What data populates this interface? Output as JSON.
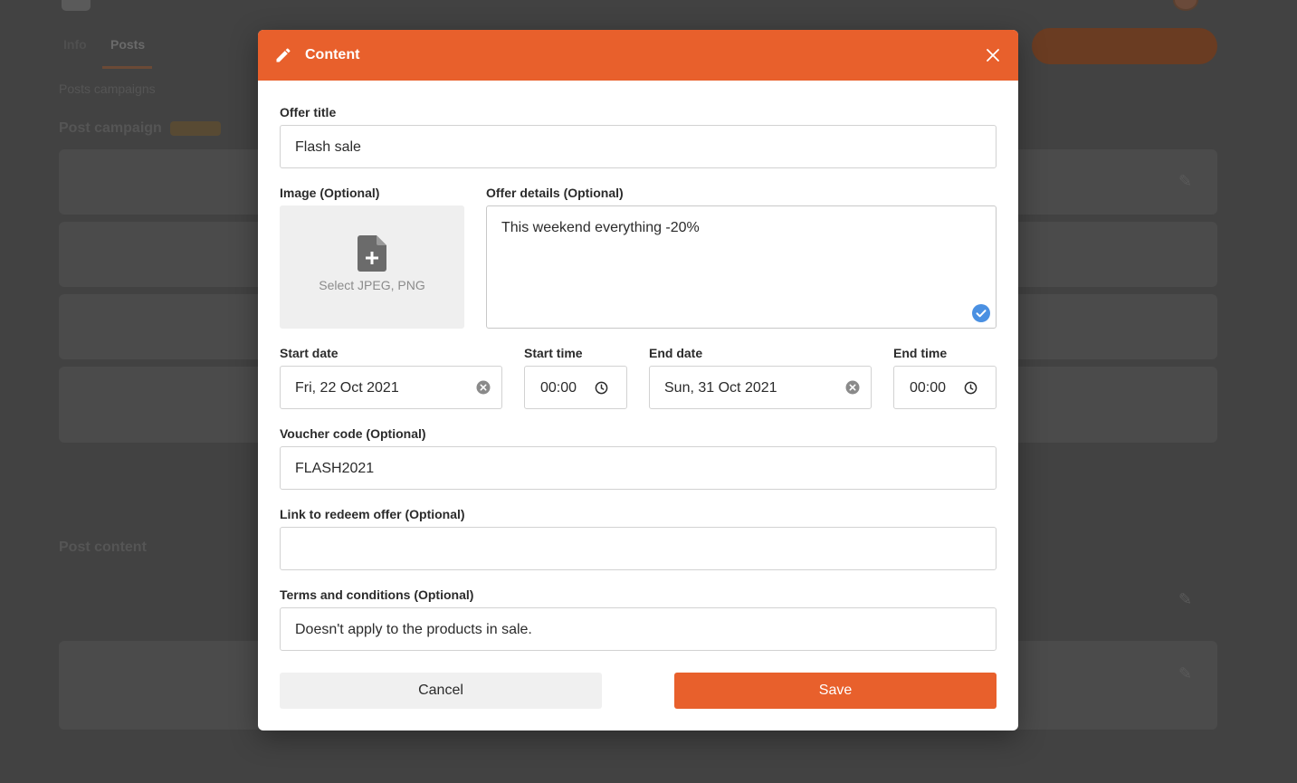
{
  "background": {
    "tabs": [
      "Info",
      "Posts"
    ],
    "breadcrumb": "Posts campaigns",
    "sections": [
      "Post campaign",
      "Post content"
    ]
  },
  "modal": {
    "title": "Content",
    "offer_title": {
      "label": "Offer title",
      "value": "Flash sale"
    },
    "image": {
      "label": "Image (Optional)",
      "hint": "Select JPEG, PNG"
    },
    "offer_details": {
      "label": "Offer details (Optional)",
      "value": "This weekend everything -20%"
    },
    "start_date": {
      "label": "Start date",
      "value": "Fri, 22 Oct 2021"
    },
    "start_time": {
      "label": "Start time",
      "value": "00:00"
    },
    "end_date": {
      "label": "End date",
      "value": "Sun, 31 Oct 2021"
    },
    "end_time": {
      "label": "End time",
      "value": "00:00"
    },
    "voucher": {
      "label": "Voucher code (Optional)",
      "value": "FLASH2021"
    },
    "link": {
      "label": "Link to redeem offer (Optional)",
      "value": ""
    },
    "terms": {
      "label": "Terms and conditions (Optional)",
      "value": "Doesn't apply to the products in sale."
    },
    "cancel_label": "Cancel",
    "save_label": "Save"
  },
  "colors": {
    "accent": "#e8602c",
    "check": "#4a90e2",
    "overlay": "#424242"
  },
  "icons": {
    "header": "pencil-icon",
    "close": "close-icon",
    "upload": "file-add-icon",
    "clear": "clear-icon",
    "clock": "clock-icon",
    "check": "check-circle-icon"
  }
}
